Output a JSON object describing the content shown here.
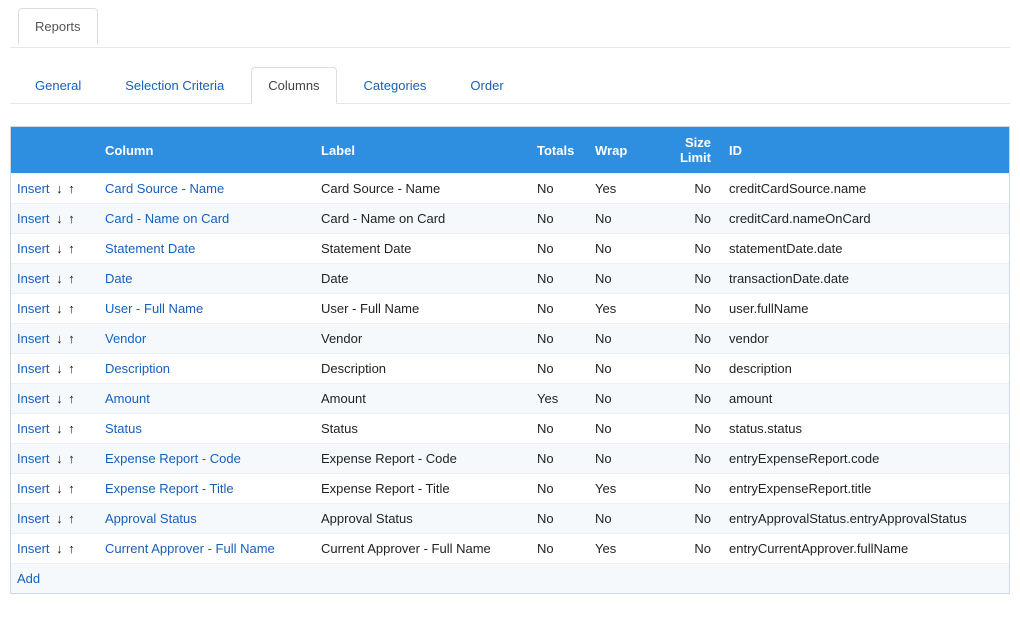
{
  "topTab": {
    "label": "Reports"
  },
  "subTabs": [
    {
      "label": "General",
      "active": false
    },
    {
      "label": "Selection Criteria",
      "active": false
    },
    {
      "label": "Columns",
      "active": true
    },
    {
      "label": "Categories",
      "active": false
    },
    {
      "label": "Order",
      "active": false
    }
  ],
  "table": {
    "headers": {
      "insert": "",
      "column": "Column",
      "label": "Label",
      "totals": "Totals",
      "wrap": "Wrap",
      "sizeLimit": "Size Limit",
      "id": "ID"
    },
    "actions": {
      "insert": "Insert",
      "add": "Add"
    },
    "rows": [
      {
        "column": "Card Source - Name",
        "label": "Card Source - Name",
        "totals": "No",
        "wrap": "Yes",
        "sizeLimit": "No",
        "id": "creditCardSource.name"
      },
      {
        "column": "Card - Name on Card",
        "label": "Card - Name on Card",
        "totals": "No",
        "wrap": "No",
        "sizeLimit": "No",
        "id": "creditCard.nameOnCard"
      },
      {
        "column": "Statement Date",
        "label": "Statement Date",
        "totals": "No",
        "wrap": "No",
        "sizeLimit": "No",
        "id": "statementDate.date"
      },
      {
        "column": "Date",
        "label": "Date",
        "totals": "No",
        "wrap": "No",
        "sizeLimit": "No",
        "id": "transactionDate.date"
      },
      {
        "column": "User - Full Name",
        "label": "User - Full Name",
        "totals": "No",
        "wrap": "Yes",
        "sizeLimit": "No",
        "id": "user.fullName"
      },
      {
        "column": "Vendor",
        "label": "Vendor",
        "totals": "No",
        "wrap": "No",
        "sizeLimit": "No",
        "id": "vendor"
      },
      {
        "column": "Description",
        "label": "Description",
        "totals": "No",
        "wrap": "No",
        "sizeLimit": "No",
        "id": "description"
      },
      {
        "column": "Amount",
        "label": "Amount",
        "totals": "Yes",
        "wrap": "No",
        "sizeLimit": "No",
        "id": "amount"
      },
      {
        "column": "Status",
        "label": "Status",
        "totals": "No",
        "wrap": "No",
        "sizeLimit": "No",
        "id": "status.status"
      },
      {
        "column": "Expense Report - Code",
        "label": "Expense Report - Code",
        "totals": "No",
        "wrap": "No",
        "sizeLimit": "No",
        "id": "entryExpenseReport.code"
      },
      {
        "column": "Expense Report - Title",
        "label": "Expense Report - Title",
        "totals": "No",
        "wrap": "Yes",
        "sizeLimit": "No",
        "id": "entryExpenseReport.title"
      },
      {
        "column": "Approval Status",
        "label": "Approval Status",
        "totals": "No",
        "wrap": "No",
        "sizeLimit": "No",
        "id": "entryApprovalStatus.entryApprovalStatus"
      },
      {
        "column": "Current Approver - Full Name",
        "label": "Current Approver - Full Name",
        "totals": "No",
        "wrap": "Yes",
        "sizeLimit": "No",
        "id": "entryCurrentApprover.fullName"
      }
    ]
  }
}
